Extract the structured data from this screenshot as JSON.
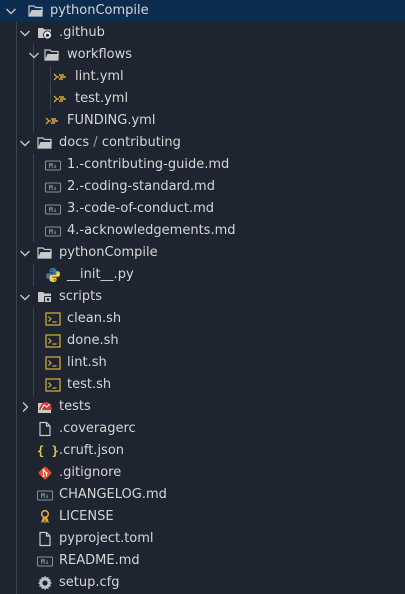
{
  "explorer": {
    "root": {
      "label": "pythonCompile",
      "expanded": true
    },
    "github": {
      "label": ".github",
      "expanded": true
    },
    "workflows": {
      "label": "workflows",
      "expanded": true
    },
    "lint_yml": {
      "label": "lint.yml"
    },
    "test_yml": {
      "label": "test.yml"
    },
    "funding": {
      "label": "FUNDING.yml"
    },
    "docs": {
      "label_a": "docs",
      "separator": "/",
      "label_b": "contributing",
      "expanded": true
    },
    "doc1": {
      "label": "1.-contributing-guide.md"
    },
    "doc2": {
      "label": "2.-coding-standard.md"
    },
    "doc3": {
      "label": "3.-code-of-conduct.md"
    },
    "doc4": {
      "label": "4.-acknowledgements.md"
    },
    "pkg": {
      "label": "pythonCompile",
      "expanded": true
    },
    "init": {
      "label": "__init__.py"
    },
    "scripts": {
      "label": "scripts",
      "expanded": true
    },
    "clean": {
      "label": "clean.sh"
    },
    "done": {
      "label": "done.sh"
    },
    "lint_sh": {
      "label": "lint.sh"
    },
    "test_sh": {
      "label": "test.sh"
    },
    "tests": {
      "label": "tests",
      "expanded": false
    },
    "coveragerc": {
      "label": ".coveragerc"
    },
    "cruft": {
      "label": ".cruft.json"
    },
    "gitignore": {
      "label": ".gitignore"
    },
    "changelog": {
      "label": "CHANGELOG.md"
    },
    "license": {
      "label": "LICENSE"
    },
    "pyproject": {
      "label": "pyproject.toml"
    },
    "readme": {
      "label": "README.md"
    },
    "setupcfg": {
      "label": "setup.cfg"
    }
  },
  "icons": {
    "folder": "folder-icon",
    "github_folder": "github-folder-icon",
    "yaml": "yaml-file-icon",
    "markdown": "markdown-file-icon",
    "python": "python-file-icon",
    "scripts_folder": "scripts-folder-icon",
    "shell": "shell-script-icon",
    "tests_folder": "tests-folder-icon",
    "file": "generic-file-icon",
    "json": "json-file-icon",
    "git": "git-file-icon",
    "license": "license-file-icon",
    "settings": "settings-file-icon"
  },
  "colors": {
    "background": "#1e2530",
    "selected_row": "#0c2d4f",
    "yaml": "#d8a833",
    "markdown": "#8a8f96",
    "python_blue": "#3b74a8",
    "python_yellow": "#f7d046",
    "shell": "#d7b33a",
    "json": "#e3c84e",
    "git": "#e24c32",
    "tests": "#d23a3a",
    "license": "#e0a43a"
  }
}
